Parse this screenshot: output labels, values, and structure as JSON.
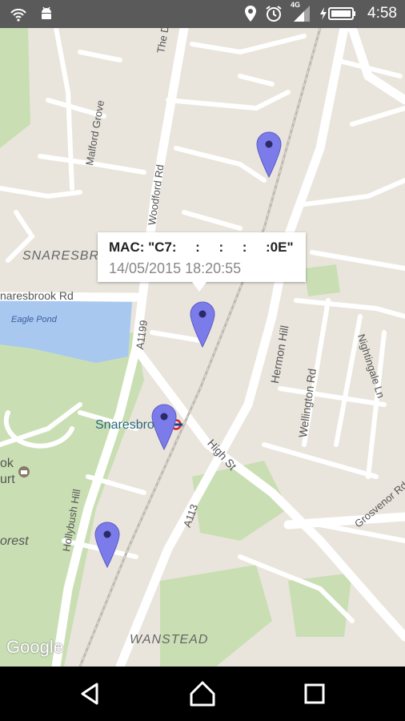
{
  "status_bar": {
    "time": "4:58",
    "network": "4G",
    "icons": [
      "wifi-signal-icon",
      "android-debug-icon",
      "location-icon",
      "alarm-icon",
      "cell-signal-icon",
      "battery-charging-icon"
    ]
  },
  "map": {
    "streets": {
      "the_drive": "The Drive",
      "malford_grove": "Malford Grove",
      "woodford_rd": "Woodford Rd",
      "snaresbrook_rd": "naresbrook Rd",
      "a1199": "A1199",
      "hermon_hill": "Hermon Hill",
      "wellington_rd": "Wellington Rd",
      "nightingale_ln": "Nightingale Ln",
      "high_st": "High St",
      "a113": "A113",
      "grosvenor_rd": "Grosvenor Rd",
      "hollybush_hill": "Hollybush Hill"
    },
    "places": {
      "snaresbrook_area": "SNARESBRO",
      "eagle_pond": "Eagle Pond",
      "snaresbrook_station": "Snaresbrook",
      "court_1": "ok",
      "court_2": "urt",
      "forest": "orest",
      "wanstead": "WANSTEAD"
    },
    "info_window": {
      "mac": "MAC: \"C7:     :     :     :     :0E\"",
      "timestamp": "14/05/2015 18:20:55"
    },
    "attribution": "Google",
    "marker_color": "#7b7bea"
  },
  "nav_bar": {
    "buttons": [
      "back-icon",
      "home-icon",
      "recents-icon"
    ]
  }
}
